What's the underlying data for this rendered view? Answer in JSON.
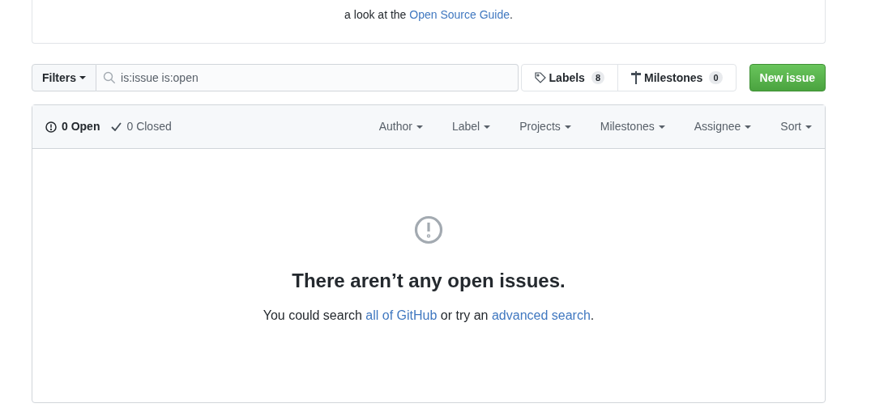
{
  "intro": {
    "segments": [
      {
        "kind": "text",
        "text": "a look at the "
      },
      {
        "kind": "link",
        "text": "Open Source Guide"
      },
      {
        "kind": "text",
        "text": "."
      }
    ]
  },
  "toolbar": {
    "filters_button": "Filters",
    "search": {
      "value": "is:issue is:open"
    },
    "labels": {
      "label": "Labels",
      "count": "8"
    },
    "milestones": {
      "label": "Milestones",
      "count": "0"
    },
    "new_issue": "New issue"
  },
  "list_header": {
    "tabs": [
      {
        "kind": "open",
        "label": "0 Open",
        "selected": true
      },
      {
        "kind": "closed",
        "label": "0 Closed",
        "selected": false
      }
    ],
    "filters": [
      "Author",
      "Label",
      "Projects",
      "Milestones",
      "Assignee",
      "Sort"
    ]
  },
  "empty_state": {
    "title": "There aren’t any open issues.",
    "segments": [
      {
        "kind": "text",
        "text": "You could search "
      },
      {
        "kind": "link",
        "text": "all of GitHub"
      },
      {
        "kind": "text",
        "text": " or try an "
      },
      {
        "kind": "link",
        "text": "advanced search"
      },
      {
        "kind": "text",
        "text": "."
      }
    ]
  }
}
